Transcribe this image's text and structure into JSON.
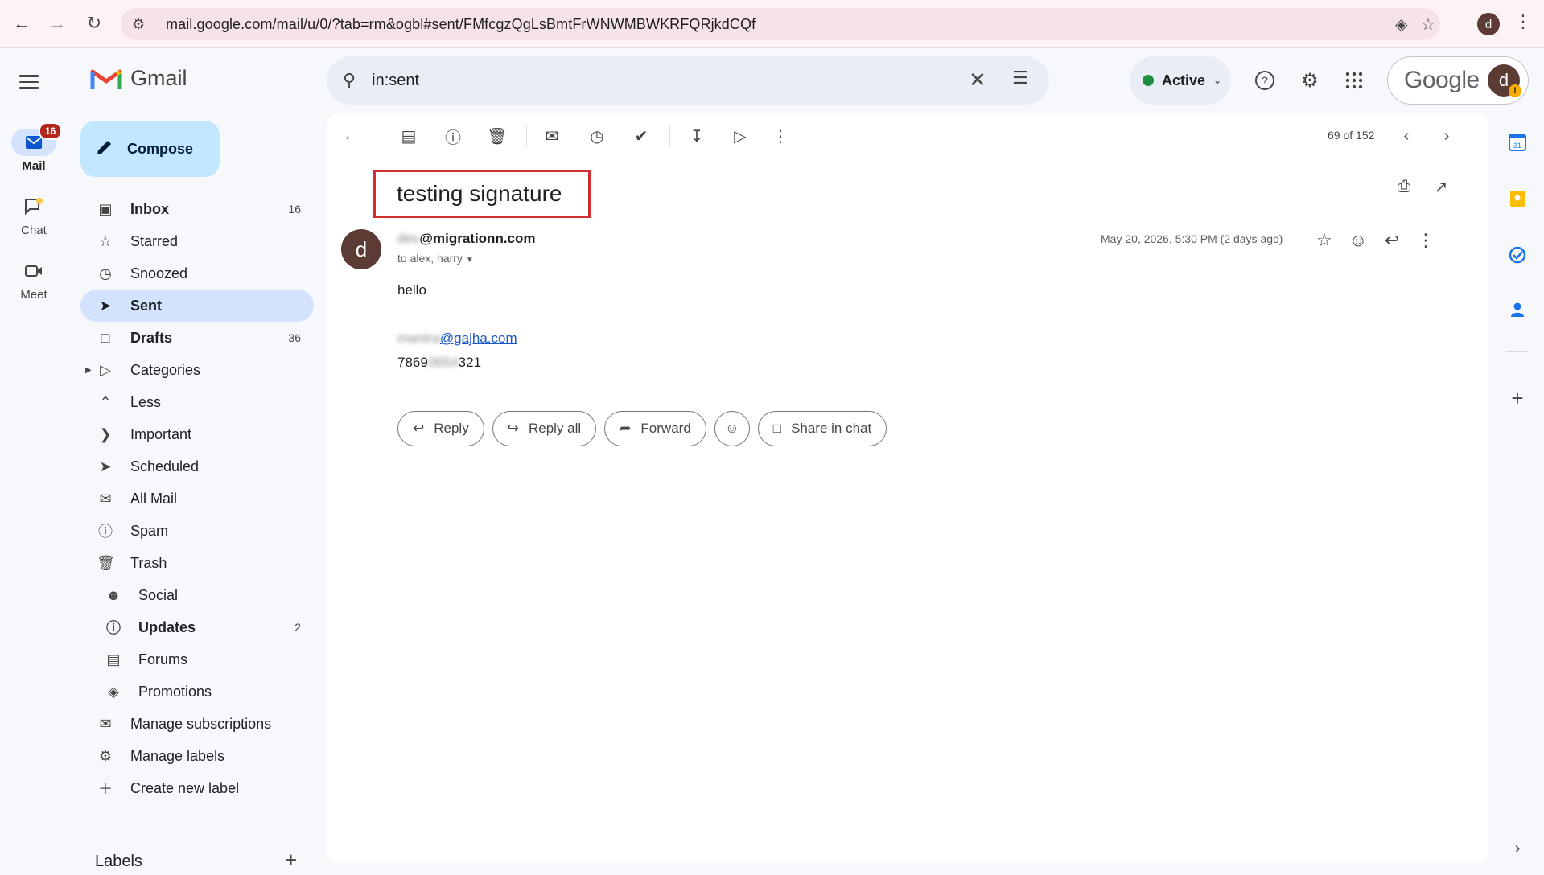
{
  "browser": {
    "url": "mail.google.com/mail/u/0/?tab=rm&ogbl#sent/FMfcgzQgLsBmtFrWNWMBWKRFQRjkdCQf",
    "profile_initial": "d"
  },
  "rail": {
    "items": [
      {
        "label": "Mail",
        "badge": "16"
      },
      {
        "label": "Chat"
      },
      {
        "label": "Meet"
      }
    ]
  },
  "app": {
    "name": "Gmail",
    "compose_label": "Compose"
  },
  "nav": {
    "items": [
      {
        "label": "Inbox",
        "count": "16"
      },
      {
        "label": "Starred"
      },
      {
        "label": "Snoozed"
      },
      {
        "label": "Sent"
      },
      {
        "label": "Drafts",
        "count": "36"
      },
      {
        "label": "Categories"
      },
      {
        "label": "Less"
      },
      {
        "label": "Important"
      },
      {
        "label": "Scheduled"
      },
      {
        "label": "All Mail"
      },
      {
        "label": "Spam"
      },
      {
        "label": "Trash"
      },
      {
        "label": "Social"
      },
      {
        "label": "Updates",
        "count": "2"
      },
      {
        "label": "Forums"
      },
      {
        "label": "Promotions"
      },
      {
        "label": "Manage subscriptions"
      },
      {
        "label": "Manage labels"
      },
      {
        "label": "Create new label"
      }
    ],
    "labels_heading": "Labels"
  },
  "header": {
    "search_value": "in:sent",
    "status_label": "Active",
    "account_brand": "Google",
    "account_initial": "d",
    "warning_glyph": "!"
  },
  "toolbar": {
    "pager": "69 of 152"
  },
  "email": {
    "subject": "testing signature",
    "sender_initial": "d",
    "sender_hidden": "dev",
    "sender_domain": "@migrationn.com",
    "to_line": "to alex, harry",
    "date": "May 20, 2026, 5:30 PM (2 days ago)",
    "body": "hello",
    "sig_email_hidden": "mantra",
    "sig_email_domain": "@gajha.com",
    "sig_phone_start": "7869",
    "sig_phone_hidden": "0654",
    "sig_phone_end": "321"
  },
  "actions": {
    "reply": "Reply",
    "reply_all": "Reply all",
    "forward": "Forward",
    "share": "Share in chat"
  },
  "colors": {
    "accent": "#c2e7ff",
    "active_nav": "#d3e3fd",
    "highlight_box": "#d32f2f",
    "status_green": "#1e8e3e"
  }
}
